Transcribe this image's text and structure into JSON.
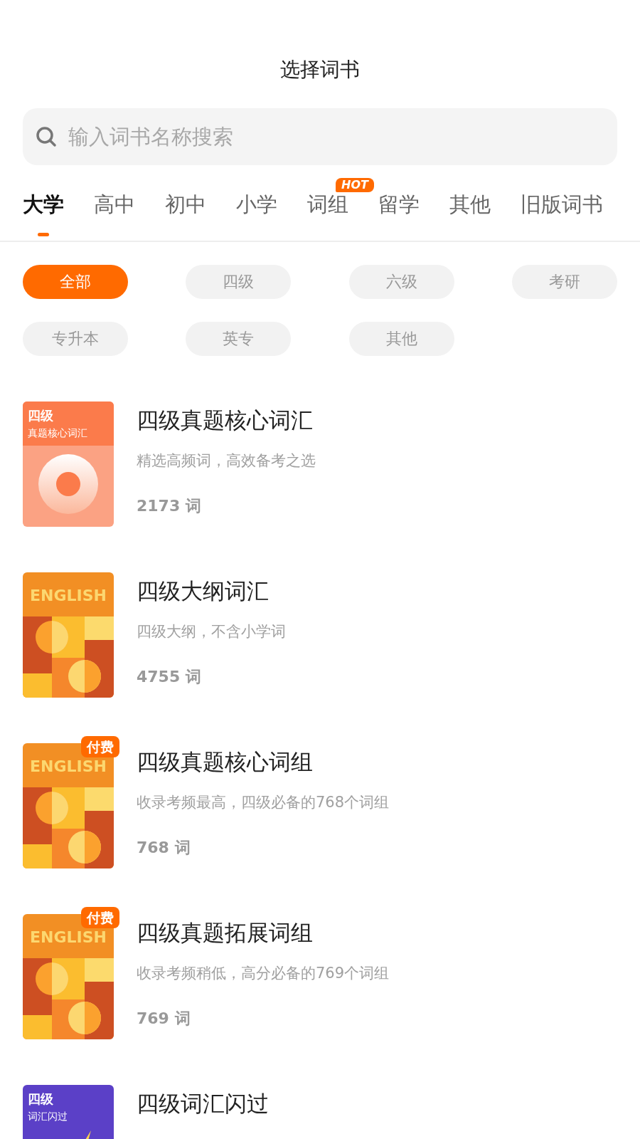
{
  "header": {
    "title": "选择词书"
  },
  "search": {
    "placeholder": "输入词书名称搜索"
  },
  "tabs": [
    {
      "label": "大学",
      "selected": true
    },
    {
      "label": "高中",
      "selected": false
    },
    {
      "label": "初中",
      "selected": false
    },
    {
      "label": "小学",
      "selected": false
    },
    {
      "label": "词组",
      "selected": false,
      "badge": "HOT"
    },
    {
      "label": "留学",
      "selected": false
    },
    {
      "label": "其他",
      "selected": false
    },
    {
      "label": "旧版词书",
      "selected": false
    }
  ],
  "filters": [
    {
      "label": "全部",
      "selected": true
    },
    {
      "label": "四级",
      "selected": false
    },
    {
      "label": "六级",
      "selected": false
    },
    {
      "label": "考研",
      "selected": false
    },
    {
      "label": "专升本",
      "selected": false
    },
    {
      "label": "英专",
      "selected": false
    },
    {
      "label": "其他",
      "selected": false
    }
  ],
  "books": [
    {
      "title": "四级真题核心词汇",
      "description": "精选高频词，高效备考之选",
      "count": "2173 词",
      "cover": {
        "kind": "donut",
        "title": "四级",
        "subtitle": "真题核心词汇"
      }
    },
    {
      "title": "四级大纲词汇",
      "description": "四级大纲，不含小学词",
      "count": "4755 词",
      "cover": {
        "kind": "english",
        "title": "ENGLISH"
      }
    },
    {
      "title": "四级真题核心词组",
      "description": "收录考频最高，四级必备的768个词组",
      "count": "768 词",
      "badge": "付费",
      "cover": {
        "kind": "english",
        "title": "ENGLISH"
      }
    },
    {
      "title": "四级真题拓展词组",
      "description": "收录考频稍低，高分必备的769个词组",
      "count": "769 词",
      "badge": "付费",
      "cover": {
        "kind": "english",
        "title": "ENGLISH"
      }
    },
    {
      "title": "四级词汇闪过",
      "cover": {
        "kind": "flash",
        "title": "四级",
        "subtitle": "词汇闪过"
      }
    }
  ]
}
